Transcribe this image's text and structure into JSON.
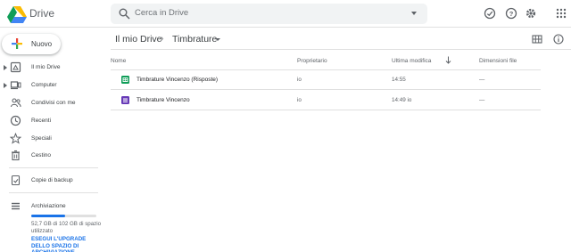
{
  "header": {
    "brand": "Drive",
    "search_placeholder": "Cerca in Drive",
    "icons": [
      "offline-status-icon",
      "help-icon",
      "settings-icon",
      "apps-grid-icon"
    ]
  },
  "sidebar": {
    "new_label": "Nuovo",
    "items": [
      {
        "label": "Il mio Drive",
        "icon": "my-drive-icon"
      },
      {
        "label": "Computer",
        "icon": "computer-icon"
      },
      {
        "label": "Condivisi con me",
        "icon": "shared-icon"
      },
      {
        "label": "Recenti",
        "icon": "clock-icon"
      },
      {
        "label": "Speciali",
        "icon": "star-icon"
      },
      {
        "label": "Cestino",
        "icon": "trash-icon"
      },
      {
        "label": "Copie di backup",
        "icon": "backup-icon"
      },
      {
        "label": "Archiviazione",
        "icon": "storage-icon"
      }
    ],
    "storage": {
      "used_fraction": 0.52,
      "text": "52,7 GB di 102 GB di spazio utilizzato",
      "upgrade": "ESEGUI L'UPGRADE DELLO SPAZIO DI ARCHIVIAZIONE"
    }
  },
  "main": {
    "breadcrumb": [
      "Il mio Drive",
      "Timbrature"
    ],
    "columns": {
      "name": "Nome",
      "owner": "Proprietario",
      "modified": "Ultima modifica",
      "size": "Dimensioni file"
    },
    "files": [
      {
        "name": "Timbrature Vincenzo (Risposte)",
        "owner": "io",
        "modified": "14:55",
        "size": "—",
        "type": "sheets",
        "color": "#0f9d58"
      },
      {
        "name": "Timbrature Vincenzo",
        "owner": "io",
        "modified": "14:49 io",
        "size": "—",
        "type": "forms",
        "color": "#673ab7"
      }
    ]
  },
  "colors": {
    "accent": "#1a73e8",
    "search_bg": "#f1f3f4"
  }
}
